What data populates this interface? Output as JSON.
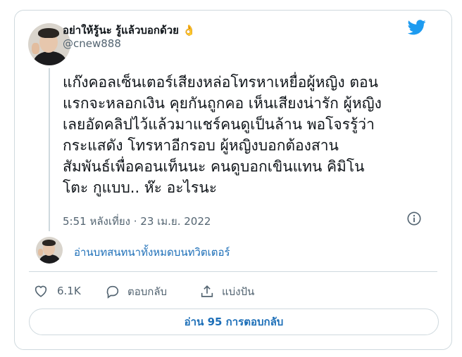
{
  "author": {
    "display_name": "อย่าให้รู้นะ รู้แล้วบอกด้วย",
    "name_emoji": "👌",
    "handle": "@cnew888"
  },
  "tweet": {
    "lines": [
      "แก๊งคอลเซ็นเตอร์เสียงหล่อโทรหาเหยื่อผู้หญิง ตอน",
      "แรกจะหลอกเงิน คุยกันถูกคอ เห็นเสียงน่ารัก ผู้หญิง",
      "เลยอัดคลิปไว้แล้วมาแชร์คนดูเป็นล้าน พอโจรรู้ว่า",
      "กระแสดัง โทรหาอีกรอบ ผู้หญิงบอกต้องสาน",
      "สัมพันธ์เพื่อคอนเท็นนะ คนดูบอกเขินแทน คิมิโน",
      "โตะ กูแบบ.. ห๊ะ อะไรนะ"
    ],
    "timestamp": "5:51 หลังเที่ยง · 23 เม.ย. 2022"
  },
  "conversation": {
    "link_label": "อ่านบทสนทนาทั้งหมดบนทวิตเตอร์"
  },
  "actions": {
    "like_count": "6.1K",
    "reply_label": "ตอบกลับ",
    "share_label": "แบ่งปัน"
  },
  "footer": {
    "read_replies_label": "อ่าน 95 การตอบกลับ"
  },
  "colors": {
    "brand": "#1d9bf0",
    "link": "#1d6fb8",
    "muted": "#536471",
    "border": "#cfd9de"
  },
  "icons": [
    "twitter-bird-icon",
    "info-icon",
    "heart-icon",
    "reply-bubble-icon",
    "share-icon"
  ]
}
